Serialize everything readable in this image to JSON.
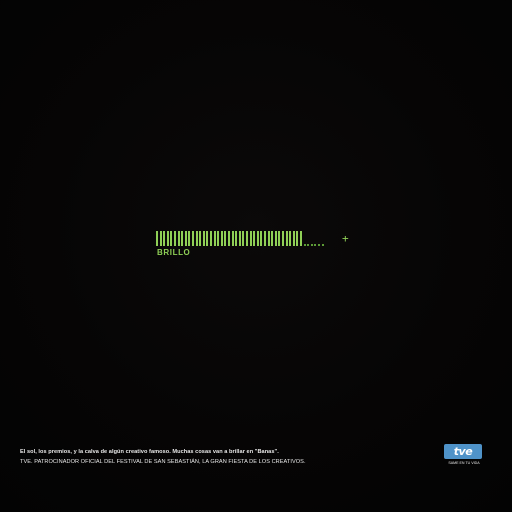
{
  "colors": {
    "osd_green": "#8fcf56",
    "osd_green_dim": "#5c9a36",
    "text_white": "#e9e9e9",
    "logo_blue": "#4f93c9",
    "logo_text": "#ffffff"
  },
  "osd": {
    "label": "BRILLO",
    "level_percent": 88,
    "trailing_marks": "_ _",
    "plus_symbol": "+"
  },
  "footer": {
    "line1": "El sol, los premios, y la calva de algún creativo famoso. Muchas cosas van a brillar en \"Banas\".",
    "line2": "TVE. Patrocinador oficial del Festival de San Sebastián, la gran fiesta de los creativos."
  },
  "logo": {
    "text": "tve",
    "tagline": "SAME EN TU VIDA",
    "icon": "tve-logo"
  }
}
